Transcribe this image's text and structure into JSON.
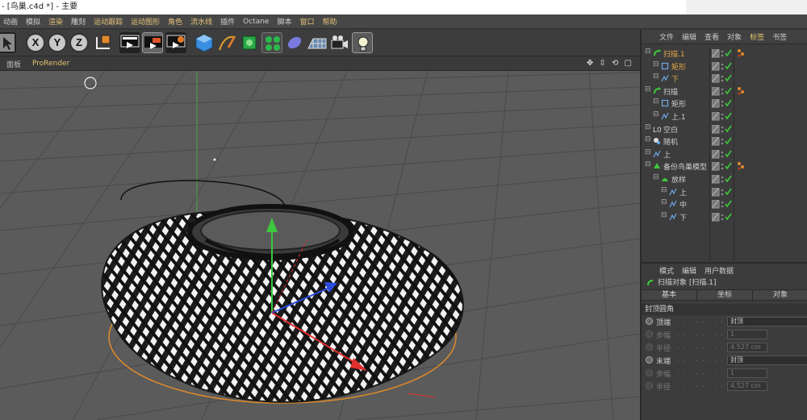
{
  "window": {
    "title": "- [鸟巢.c4d *] - 主要"
  },
  "menubar": {
    "items": [
      {
        "label": "动画",
        "hl": false
      },
      {
        "label": "模拟",
        "hl": false
      },
      {
        "label": "渲染",
        "hl": true
      },
      {
        "label": "雕刻",
        "hl": false
      },
      {
        "label": "运动跟踪",
        "hl": true
      },
      {
        "label": "运动图形",
        "hl": true
      },
      {
        "label": "角色",
        "hl": true
      },
      {
        "label": "流水线",
        "hl": true
      },
      {
        "label": "插件",
        "hl": false
      },
      {
        "label": "Octane",
        "hl": false
      },
      {
        "label": "脚本",
        "hl": false
      },
      {
        "label": "窗口",
        "hl": true
      },
      {
        "label": "帮助",
        "hl": true
      }
    ]
  },
  "toolbar": {
    "x_label": "X",
    "y_label": "Y",
    "z_label": "Z",
    "icons": [
      "select-arrow-icon",
      "axis-x-icon",
      "axis-y-icon",
      "axis-z-icon",
      "coordinate-system-icon",
      "render-region-icon",
      "render-view-icon",
      "render-settings-icon",
      "cube-icon",
      "pen-spline-icon",
      "subdivision-icon",
      "cloner-icon",
      "deformer-icon",
      "floor-icon",
      "camera-icon",
      "light-icon"
    ]
  },
  "viewport": {
    "tabs": [
      {
        "label": "面板",
        "active": false
      },
      {
        "label": "ProRender",
        "active": true
      }
    ],
    "nav_icons": "✥ ⇳ ⟲ ▢"
  },
  "object_manager": {
    "tabs": [
      {
        "label": "文件",
        "active": false
      },
      {
        "label": "编辑",
        "active": false
      },
      {
        "label": "查看",
        "active": false
      },
      {
        "label": "对象",
        "active": false
      },
      {
        "label": "标签",
        "active": true
      },
      {
        "label": "书签",
        "active": false
      }
    ],
    "rows": [
      {
        "name": "扫描.1",
        "indent": 0,
        "icon": "sweep-icon",
        "orange": true,
        "tag": true
      },
      {
        "name": "矩形",
        "indent": 1,
        "icon": "rectangle-icon",
        "orange": true,
        "tag": false
      },
      {
        "name": "下",
        "indent": 1,
        "icon": "spline-icon",
        "orange": true,
        "tag": false
      },
      {
        "name": "扫描",
        "indent": 0,
        "icon": "sweep-icon",
        "orange": false,
        "tag": true
      },
      {
        "name": "矩形",
        "indent": 1,
        "icon": "rectangle-icon",
        "orange": false,
        "tag": false
      },
      {
        "name": "上.1",
        "indent": 1,
        "icon": "spline-icon",
        "orange": false,
        "tag": false
      },
      {
        "name": "空白",
        "indent": 0,
        "icon": "null-icon",
        "orange": false,
        "tag": false
      },
      {
        "name": "随机",
        "indent": 0,
        "icon": "random-effector-icon",
        "orange": false,
        "tag": false
      },
      {
        "name": "上",
        "indent": 0,
        "icon": "spline-icon",
        "orange": false,
        "tag": false
      },
      {
        "name": "备份鸟巢模型",
        "indent": 0,
        "icon": "backup-model-icon",
        "orange": false,
        "tag": true
      },
      {
        "name": "放样",
        "indent": 1,
        "icon": "loft-icon",
        "orange": false,
        "tag": false
      },
      {
        "name": "上",
        "indent": 2,
        "icon": "spline-icon",
        "orange": false,
        "tag": false
      },
      {
        "name": "中",
        "indent": 2,
        "icon": "spline-icon",
        "orange": false,
        "tag": false
      },
      {
        "name": "下",
        "indent": 2,
        "icon": "spline-icon",
        "orange": false,
        "tag": false
      }
    ]
  },
  "attributes": {
    "tabs": [
      "模式",
      "编辑",
      "用户数据"
    ],
    "object_title": "扫描对象 [扫描.1]",
    "subtabs": [
      "基本",
      "坐标",
      "对象"
    ],
    "section": "封顶圆角",
    "props": [
      {
        "label": "顶端",
        "radio": true,
        "value": "封顶",
        "dim": false
      },
      {
        "label": "步幅",
        "radio": false,
        "value": "1",
        "dim": true
      },
      {
        "label": "半径",
        "radio": false,
        "value": "4.527 cm",
        "dim": true
      },
      {
        "label": "末端",
        "radio": true,
        "value": "封顶",
        "dim": false
      },
      {
        "label": "步幅",
        "radio": false,
        "value": "1",
        "dim": true
      },
      {
        "label": "半径",
        "radio": false,
        "value": "4.527 cm",
        "dim": true
      }
    ]
  },
  "colors": {
    "accent": "#e0c26e",
    "check_green": "#3cc83c",
    "panel": "#3c3c3c",
    "viewport_bg": "#5a5a5a"
  }
}
